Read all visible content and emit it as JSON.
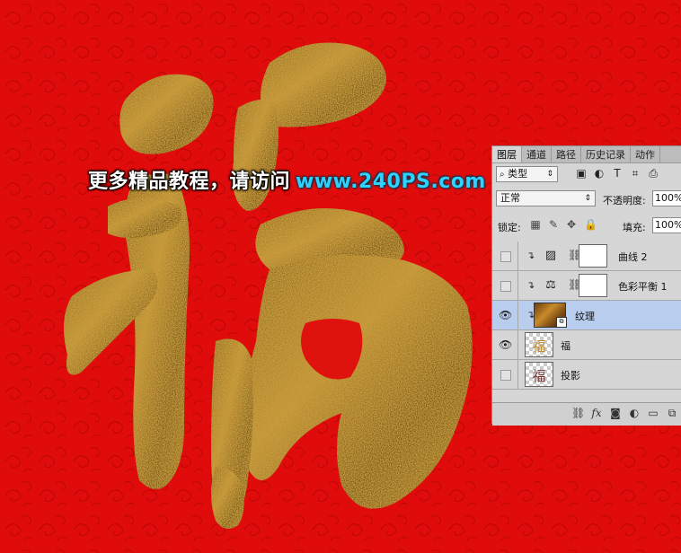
{
  "colors": {
    "background_red": "#e00c0c",
    "swirl_red": "#c40606",
    "gold_dark": "#5a3a08",
    "gold_mid": "#a8741c",
    "gold_light": "#e8c060",
    "panel_gray": "#d6d6d6",
    "selected_row": "#b9cdef",
    "watermark_url": "#2fd2ff"
  },
  "watermark": {
    "chinese": "更多精品教程，请访问",
    "url": "www.240PS.com"
  },
  "layers_panel": {
    "tabs": [
      {
        "label": "图层",
        "icon": null
      },
      {
        "label": "通道",
        "icon": null
      },
      {
        "label": "路径",
        "icon": null
      },
      {
        "label": "历史记录",
        "icon": null
      },
      {
        "label": "动作",
        "icon": null
      }
    ],
    "active_tab": "图层",
    "filter_kind": "类型",
    "filter_icons": [
      "image-filter-icon",
      "adjustment-filter-icon",
      "type-filter-icon",
      "shape-filter-icon",
      "smart-object-filter-icon"
    ],
    "blend_mode": "正常",
    "opacity_label": "不透明度:",
    "opacity_value": "100%",
    "lock_label": "锁定:",
    "lock_icons": [
      "lock-transparent-icon",
      "lock-image-icon",
      "lock-position-icon",
      "lock-all-icon"
    ],
    "fill_label": "填充:",
    "fill_value": "100%",
    "layers": [
      {
        "name": "曲线 2",
        "visible": false,
        "clipped": true,
        "type": "adjustment",
        "icon": "curves-icon"
      },
      {
        "name": "色彩平衡 1",
        "visible": false,
        "clipped": true,
        "type": "adjustment",
        "icon": "color-balance-icon"
      },
      {
        "name": "纹理",
        "visible": true,
        "clipped": true,
        "type": "smart",
        "selected": true
      },
      {
        "name": "福",
        "visible": true,
        "clipped": false,
        "type": "pixel",
        "thumb": "福"
      },
      {
        "name": "投影",
        "visible": false,
        "clipped": false,
        "type": "pixel",
        "thumb": "福"
      }
    ],
    "footer_icons": [
      "link-layers-icon",
      "fx-icon",
      "add-mask-icon",
      "new-adjustment-icon",
      "new-group-icon",
      "new-layer-icon"
    ],
    "footer_fx_label": "fx"
  }
}
